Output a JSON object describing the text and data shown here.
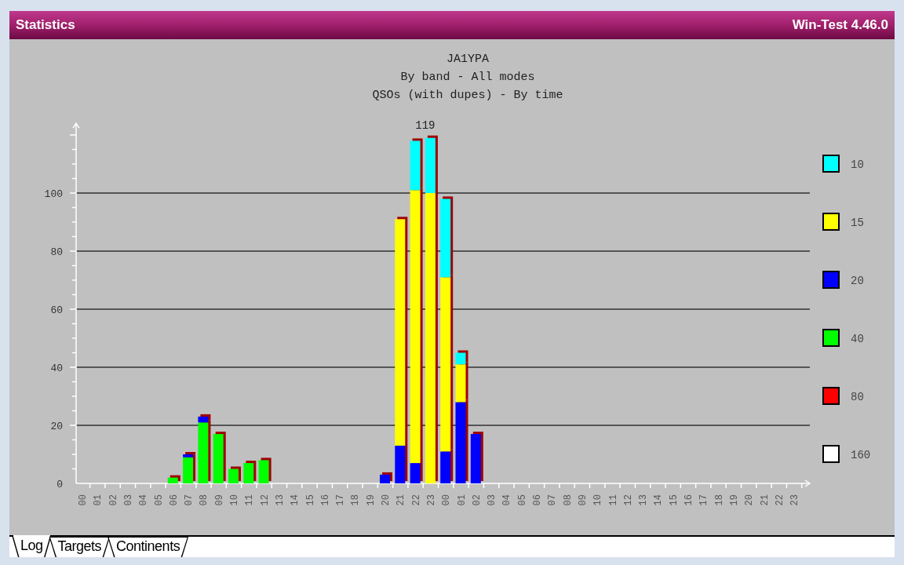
{
  "window": {
    "title": "Statistics",
    "app_version": "Win-Test 4.46.0"
  },
  "chart": {
    "subtitles": [
      "By band - All modes",
      "QSOs (with dupes) - By time"
    ],
    "chart_data": {
      "type": "bar",
      "title": "JA1YPA",
      "stacked": true,
      "orientation": "vertical",
      "categories": [
        "00",
        "01",
        "02",
        "03",
        "04",
        "05",
        "06",
        "07",
        "08",
        "09",
        "10",
        "11",
        "12",
        "13",
        "14",
        "15",
        "16",
        "17",
        "18",
        "19",
        "20",
        "21",
        "22",
        "23",
        "00",
        "01",
        "02",
        "03",
        "04",
        "05",
        "06",
        "07",
        "08",
        "09",
        "10",
        "11",
        "12",
        "13",
        "14",
        "15",
        "16",
        "17",
        "18",
        "19",
        "20",
        "21",
        "22",
        "23"
      ],
      "series": [
        {
          "name": "10",
          "color": "#00ffff",
          "values": [
            0,
            0,
            0,
            0,
            0,
            0,
            0,
            0,
            0,
            0,
            0,
            0,
            0,
            0,
            0,
            0,
            0,
            0,
            0,
            0,
            0,
            0,
            17,
            19,
            27,
            4,
            0,
            0,
            0,
            0,
            0,
            0,
            0,
            0,
            0,
            0,
            0,
            0,
            0,
            0,
            0,
            0,
            0,
            0,
            0,
            0,
            0,
            0
          ]
        },
        {
          "name": "15",
          "color": "#ffff00",
          "values": [
            0,
            0,
            0,
            0,
            0,
            0,
            0,
            0,
            0,
            0,
            0,
            0,
            0,
            0,
            0,
            0,
            0,
            0,
            0,
            0,
            0,
            78,
            94,
            100,
            60,
            13,
            0,
            0,
            0,
            0,
            0,
            0,
            0,
            0,
            0,
            0,
            0,
            0,
            0,
            0,
            0,
            0,
            0,
            0,
            0,
            0,
            0,
            0
          ]
        },
        {
          "name": "20",
          "color": "#0000ff",
          "values": [
            0,
            0,
            0,
            0,
            0,
            0,
            0,
            1,
            2,
            0,
            0,
            0,
            0,
            0,
            0,
            0,
            0,
            0,
            0,
            0,
            3,
            13,
            7,
            0,
            11,
            28,
            17,
            0,
            0,
            0,
            0,
            0,
            0,
            0,
            0,
            0,
            0,
            0,
            0,
            0,
            0,
            0,
            0,
            0,
            0,
            0,
            0,
            0
          ]
        },
        {
          "name": "40",
          "color": "#00ff00",
          "values": [
            0,
            0,
            0,
            0,
            0,
            0,
            2,
            9,
            21,
            17,
            5,
            7,
            8,
            0,
            0,
            0,
            0,
            0,
            0,
            0,
            0,
            0,
            0,
            0,
            0,
            0,
            0,
            0,
            0,
            0,
            0,
            0,
            0,
            0,
            0,
            0,
            0,
            0,
            0,
            0,
            0,
            0,
            0,
            0,
            0,
            0,
            0,
            0
          ]
        },
        {
          "name": "80",
          "color": "#ff0000",
          "values": [
            0,
            0,
            0,
            0,
            0,
            0,
            0,
            0,
            0,
            0,
            0,
            0,
            0,
            0,
            0,
            0,
            0,
            0,
            0,
            0,
            0,
            0,
            0,
            0,
            0,
            0,
            0,
            0,
            0,
            0,
            0,
            0,
            0,
            0,
            0,
            0,
            0,
            0,
            0,
            0,
            0,
            0,
            0,
            0,
            0,
            0,
            0,
            0
          ]
        },
        {
          "name": "160",
          "color": "#ffffff",
          "values": [
            0,
            0,
            0,
            0,
            0,
            0,
            0,
            0,
            0,
            0,
            0,
            0,
            0,
            0,
            0,
            0,
            0,
            0,
            0,
            0,
            0,
            0,
            0,
            0,
            0,
            0,
            0,
            0,
            0,
            0,
            0,
            0,
            0,
            0,
            0,
            0,
            0,
            0,
            0,
            0,
            0,
            0,
            0,
            0,
            0,
            0,
            0,
            0
          ]
        }
      ],
      "ylim": [
        0,
        124
      ],
      "yticks": [
        0,
        20,
        40,
        60,
        80,
        100
      ],
      "grid": true,
      "legend": true,
      "annotations": [
        {
          "x": "23",
          "y": 119,
          "text": "119"
        }
      ]
    }
  },
  "tabs": [
    {
      "label": "Log",
      "selected": true
    },
    {
      "label": "Targets",
      "selected": false
    },
    {
      "label": "Continents",
      "selected": false
    }
  ]
}
